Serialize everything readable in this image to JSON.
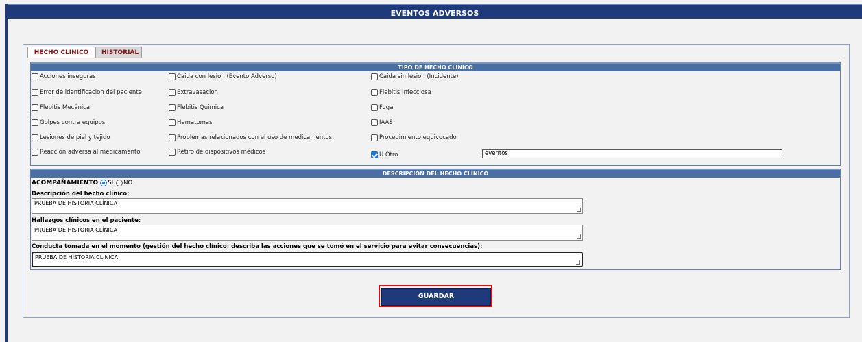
{
  "header": {
    "title": "EVENTOS ADVERSOS"
  },
  "tabs": [
    {
      "label": "HECHO CLINICO",
      "active": true
    },
    {
      "label": "HISTORIAL",
      "active": false
    }
  ],
  "tipo_section": {
    "title": "TIPO DE HECHO CLINICO",
    "options": [
      {
        "label": "Acciones inseguras",
        "checked": false
      },
      {
        "label": "Caida con lesion (Evento Adverso)",
        "checked": false
      },
      {
        "label": "Caida sin lesion (Incidente)",
        "checked": false
      },
      {
        "label": "Error de identificacion del paciente",
        "checked": false
      },
      {
        "label": "Extravasacion",
        "checked": false
      },
      {
        "label": "Flebitis Infecciosa",
        "checked": false
      },
      {
        "label": "Flebitis Mecánica",
        "checked": false
      },
      {
        "label": "Flebitis Quimica",
        "checked": false
      },
      {
        "label": "Fuga",
        "checked": false
      },
      {
        "label": "Golpes contra equipos",
        "checked": false
      },
      {
        "label": "Hematomas",
        "checked": false
      },
      {
        "label": "IAAS",
        "checked": false
      },
      {
        "label": "Lesiones de piel y tejido",
        "checked": false
      },
      {
        "label": "Problemas relacionados con el uso de medicamentos",
        "checked": false
      },
      {
        "label": "Procedimiento equivocado",
        "checked": false
      },
      {
        "label": "Reacción adversa al medicamento",
        "checked": false
      },
      {
        "label": "Retiro de dispositivos médicos",
        "checked": false
      },
      {
        "label": "U Otro",
        "checked": true
      }
    ],
    "other_value": "eventos"
  },
  "descripcion_section": {
    "title": "DESCRIPCIÓN DEL HECHO CLINICO",
    "acompanamiento_label": "ACOMPAÑAMIENTO",
    "radio_si": "SI",
    "radio_no": "NO",
    "selected": "SI",
    "fields": [
      {
        "label": "Descripción del hecho clínico:",
        "value": "PRUEBA DE HISTORIA CLÍNICA"
      },
      {
        "label": "Hallazgos clínicos en el paciente:",
        "value": "PRUEBA DE HISTORIA CLÍNICA"
      },
      {
        "label": "Conducta tomada en el momento (gestión del hecho clínico: describa las acciones que se tomó en el servicio para evitar consecuencias):",
        "value": "PRUEBA DE HISTORIA CLÍNICA"
      }
    ]
  },
  "actions": {
    "save_label": "GUARDAR"
  },
  "colors": {
    "header_bg": "#1f3a7a",
    "section_header_bg": "#4a6fa5",
    "tab_text": "#8b1a1a",
    "highlight": "#e01010",
    "checkbox_checked": "#1a73e8"
  }
}
